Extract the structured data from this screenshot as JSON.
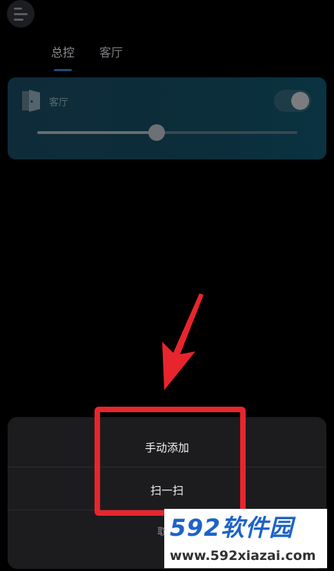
{
  "tabs": [
    {
      "label": "总控",
      "active": true
    },
    {
      "label": "客厅",
      "active": false
    }
  ],
  "room_card": {
    "label": "客厅",
    "switch_on": true,
    "brightness_fraction": 0.46
  },
  "action_sheet": {
    "items": [
      {
        "label": "手动添加"
      },
      {
        "label": "扫一扫"
      }
    ],
    "cancel_label": "取消"
  },
  "watermark": {
    "brand": "592软件园",
    "url": "www.592xiazai.com"
  },
  "colors": {
    "highlight": "#e8252d",
    "tab_underline": "#1f4e80",
    "watermark_blue": "#1d63c8"
  },
  "icons": {
    "menu": "menu-icon",
    "door": "door-icon",
    "arrow": "arrow-down-left-icon"
  }
}
